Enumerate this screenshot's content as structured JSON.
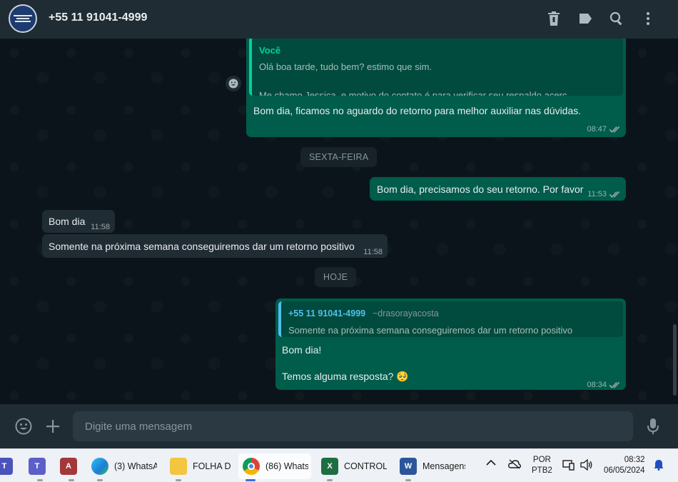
{
  "header": {
    "contact_name": "+55 11 91041-4999",
    "icons": [
      "trash-icon",
      "label-icon",
      "search-icon",
      "kebab-menu-icon"
    ]
  },
  "messages": {
    "m1": {
      "quote_author": "Você",
      "quote_line1": "Olá boa tarde, tudo bem? estimo que sim.",
      "quote_line2": "Me chamo Jessica, e motivo do contato é para verificar seu respaldo acerc...",
      "text": "Bom dia, ficamos no aguardo do retorno para melhor auxiliar nas dúvidas.",
      "time": "08:47"
    },
    "day1": "SEXTA-FEIRA",
    "m2": {
      "text": "Bom dia, precisamos do seu retorno. Por favor",
      "time": "11:53"
    },
    "m3": {
      "text": "Bom dia",
      "time": "11:58"
    },
    "m4": {
      "text": "Somente na próxima semana conseguiremos dar um retorno positivo",
      "time": "11:58"
    },
    "day2": "HOJE",
    "m5": {
      "quote_author": "+55 11 91041-4999",
      "quote_alias": "~drasorayacosta",
      "quote_text": "Somente na próxima semana conseguiremos dar um retorno positivo",
      "line1": "Bom dia!",
      "line2": "Temos alguma resposta? 🥺",
      "time": "08:34"
    }
  },
  "composer": {
    "placeholder": "Digite uma mensagem"
  },
  "taskbar": {
    "apps": {
      "whatsapp": "(3) WhatsA",
      "folder": "FOLHA D",
      "chrome": "(86) Whats",
      "excel": "CONTROLE",
      "word": "Mensagens"
    },
    "lang_line1": "POR",
    "lang_line2": "PTB2",
    "clock_time": "08:32",
    "clock_date": "06/05/2024"
  },
  "colors": {
    "header_bg": "#202c33",
    "chat_bg": "#0b141a",
    "outgoing_bubble": "#005c4b",
    "incoming_bubble": "#202c33",
    "accent_green": "#06cf9c",
    "quote_author_blue": "#53bdeb"
  }
}
